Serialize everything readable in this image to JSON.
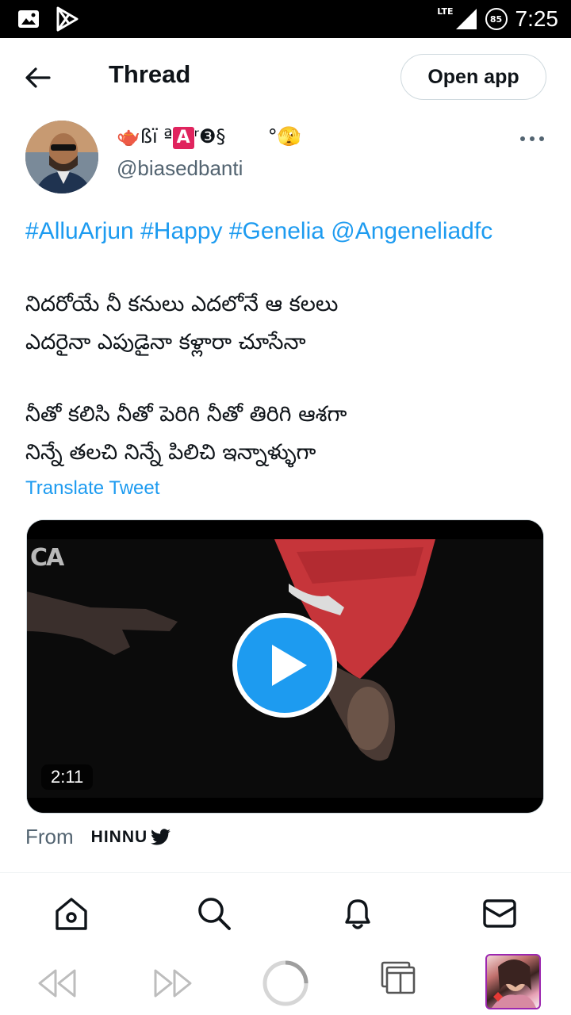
{
  "status_bar": {
    "network": "LTE",
    "battery": "85",
    "time": "7:25"
  },
  "header": {
    "title": "Thread",
    "open_app_label": "Open app"
  },
  "author": {
    "name_prefix": "🫖ßï ª",
    "name_badge": "A",
    "name_suffix": "ʳ❸§",
    "name_emoji": "°🫣",
    "handle": "@biasedbanti"
  },
  "tweet": {
    "tags": [
      "#AlluArjun",
      "#Happy",
      "#Genelia",
      "@Angeneliadfc"
    ],
    "lines": [
      "నిదరోయే నీ కనులు ఎదలోనే ఆ కలలు",
      "ఎదరైనా ఎపుడైనా కళ్లారా చూసేనా",
      "నీతో కలిసి నీతో పెరిగి నీతో తిరిగి ఆశగా",
      "నిన్నే తలచి నిన్నే పిలిచి ఇన్నాళ్ళుగా"
    ],
    "translate_label": "Translate Tweet"
  },
  "video": {
    "duration": "2:11",
    "watermark": "CA"
  },
  "from": {
    "label": "From",
    "source": "HINNU"
  },
  "colors": {
    "accent": "#1d9bf0",
    "text": "#0f1419",
    "secondary_text": "#536471",
    "border": "#cfd9de"
  },
  "icons": {
    "status_left": [
      "gallery-icon",
      "play-store-icon"
    ],
    "bottom_nav": [
      "home-icon",
      "search-icon",
      "notifications-icon",
      "messages-icon"
    ],
    "browser_bar": [
      "rewind-icon",
      "fast-forward-icon",
      "loading-icon",
      "tabs-icon",
      "page-thumbnail"
    ]
  }
}
